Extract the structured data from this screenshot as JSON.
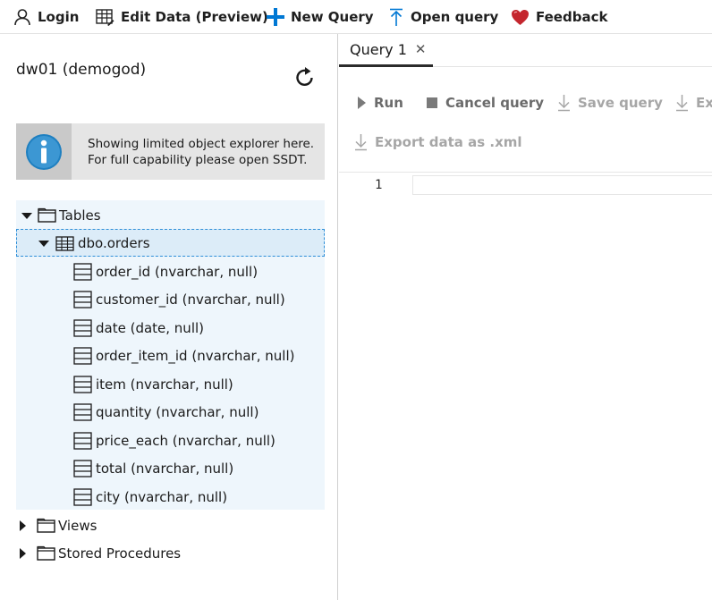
{
  "toolbar": {
    "login": "Login",
    "edit_data": "Edit Data (Preview)",
    "new_query": "New Query",
    "open_query": "Open query",
    "feedback": "Feedback"
  },
  "explorer": {
    "db_title": "dw01 (demogod)",
    "info_line1": "Showing limited object explorer here.",
    "info_line2": "For full capability please open SSDT.",
    "tables_label": "Tables",
    "table_name": "dbo.orders",
    "columns": [
      "order_id (nvarchar, null)",
      "customer_id (nvarchar, null)",
      "date (date, null)",
      "order_item_id (nvarchar, null)",
      "item (nvarchar, null)",
      "quantity (nvarchar, null)",
      "price_each (nvarchar, null)",
      "total (nvarchar, null)",
      "city (nvarchar, null)"
    ],
    "views_label": "Views",
    "procs_label": "Stored Procedures"
  },
  "editor": {
    "tab_label": "Query 1",
    "tab_close": "✕",
    "run": "Run",
    "cancel": "Cancel query",
    "save": "Save query",
    "export_partial": "Ex",
    "export_xml": "Export data as .xml",
    "line_number": "1"
  },
  "colors": {
    "accent_blue": "#0078d4",
    "heart_red": "#c4262e",
    "tree_bg": "#eef6fc",
    "info_bg": "#e5e5e5"
  }
}
